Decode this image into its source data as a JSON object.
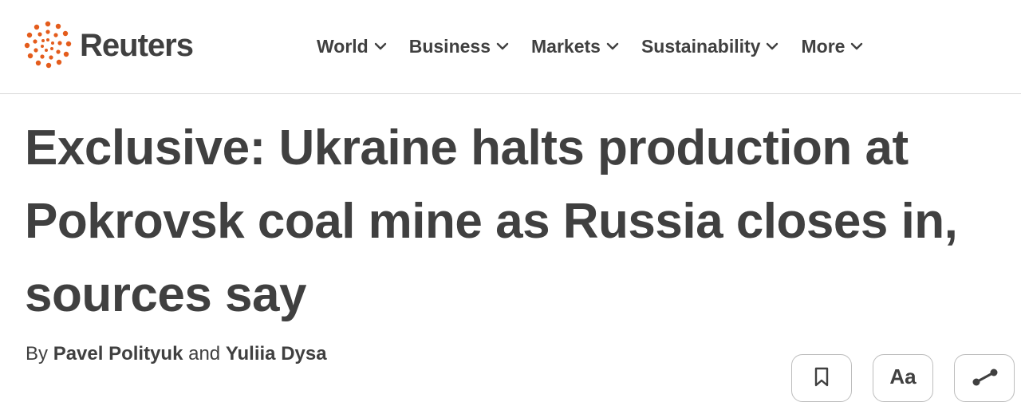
{
  "brand": {
    "name": "Reuters",
    "accent": "#e45c1c"
  },
  "nav": {
    "items": [
      {
        "label": "World"
      },
      {
        "label": "Business"
      },
      {
        "label": "Markets"
      },
      {
        "label": "Sustainability"
      },
      {
        "label": "More"
      }
    ]
  },
  "article": {
    "headline": "Exclusive: Ukraine halts production at Pokrovsk coal mine as Russia closes in, sources say",
    "byline": {
      "prefix": "By",
      "author1": "Pavel Polityuk",
      "joiner": "and",
      "author2": "Yuliia Dysa"
    }
  },
  "toolbar": {
    "bookmark_icon": "bookmark-icon",
    "text_size_label": "Aa",
    "share_icon": "share-icon"
  }
}
